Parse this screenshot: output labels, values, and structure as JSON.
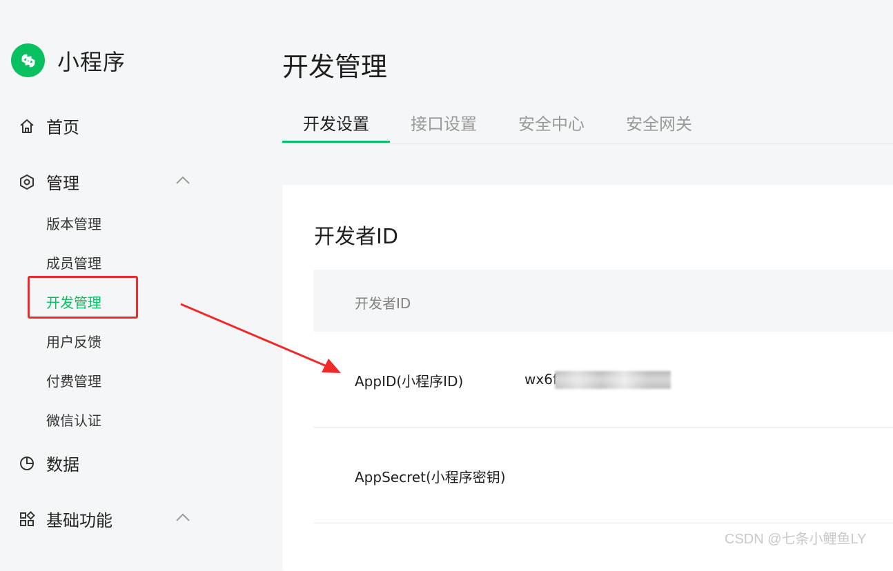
{
  "app": {
    "name": "小程序",
    "logo_icon": "mini-program-logo-icon",
    "brand_color": "#07c160"
  },
  "sidebar": {
    "home": {
      "label": "首页",
      "icon": "home-icon"
    },
    "manage": {
      "label": "管理",
      "icon": "hexagon-settings-icon",
      "expanded": true,
      "items": [
        "版本管理",
        "成员管理",
        "开发管理",
        "用户反馈",
        "付费管理",
        "微信认证"
      ],
      "active_item": "开发管理"
    },
    "data": {
      "label": "数据",
      "icon": "pie-chart-icon"
    },
    "basic": {
      "label": "基础功能",
      "icon": "grid-apps-icon",
      "expanded": true
    }
  },
  "main": {
    "title": "开发管理",
    "tabs": [
      "开发设置",
      "接口设置",
      "安全中心",
      "安全网关"
    ],
    "active_tab": "开发设置",
    "section": {
      "title": "开发者ID",
      "table_header": "开发者ID",
      "rows": [
        {
          "label": "AppID(小程序ID)",
          "value": "wx6f"
        },
        {
          "label": "AppSecret(小程序密钥)",
          "value": ""
        }
      ]
    }
  },
  "annotation": {
    "highlight_color": "#ef2a2a",
    "arrow_color": "#ef2a2a"
  },
  "watermark": "CSDN @七条小鲤鱼LY"
}
